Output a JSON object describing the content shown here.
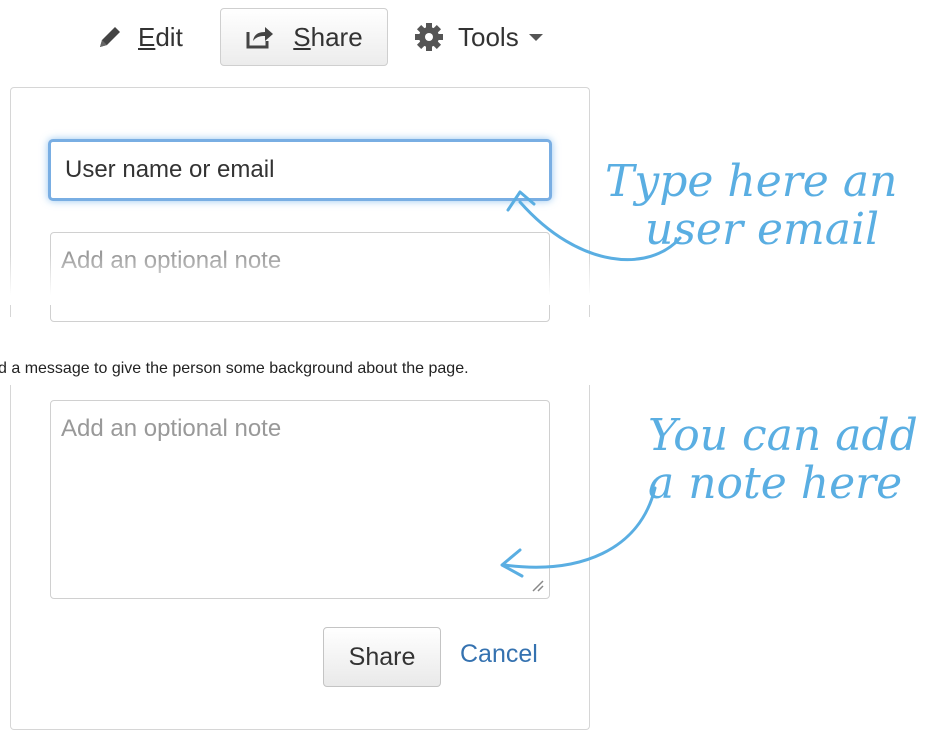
{
  "toolbar": {
    "edit": {
      "mnemonic": "E",
      "rest": "dit",
      "icon": "pencil-icon"
    },
    "share": {
      "mnemonic": "S",
      "rest": "hare",
      "icon": "share-icon"
    },
    "tools": {
      "label": "Tools",
      "icon": "gear-icon"
    }
  },
  "share_dialog": {
    "user_input_placeholder": "User name or email",
    "note_placeholder": "Add an optional note"
  },
  "annotations": {
    "user_hint_line1": "Type here an",
    "user_hint_line2": "user email",
    "note_hint_line1": "You can add",
    "note_hint_line2": "a note here"
  },
  "caption": "d a message to give the person some background about the page.",
  "note_dialog": {
    "note_placeholder": "Add an optional note",
    "share_label": "Share",
    "cancel_label": "Cancel"
  },
  "colors": {
    "accent_blue": "#3572b0",
    "focus_glow": "#79aee3",
    "annotation": "#5aaee2"
  }
}
